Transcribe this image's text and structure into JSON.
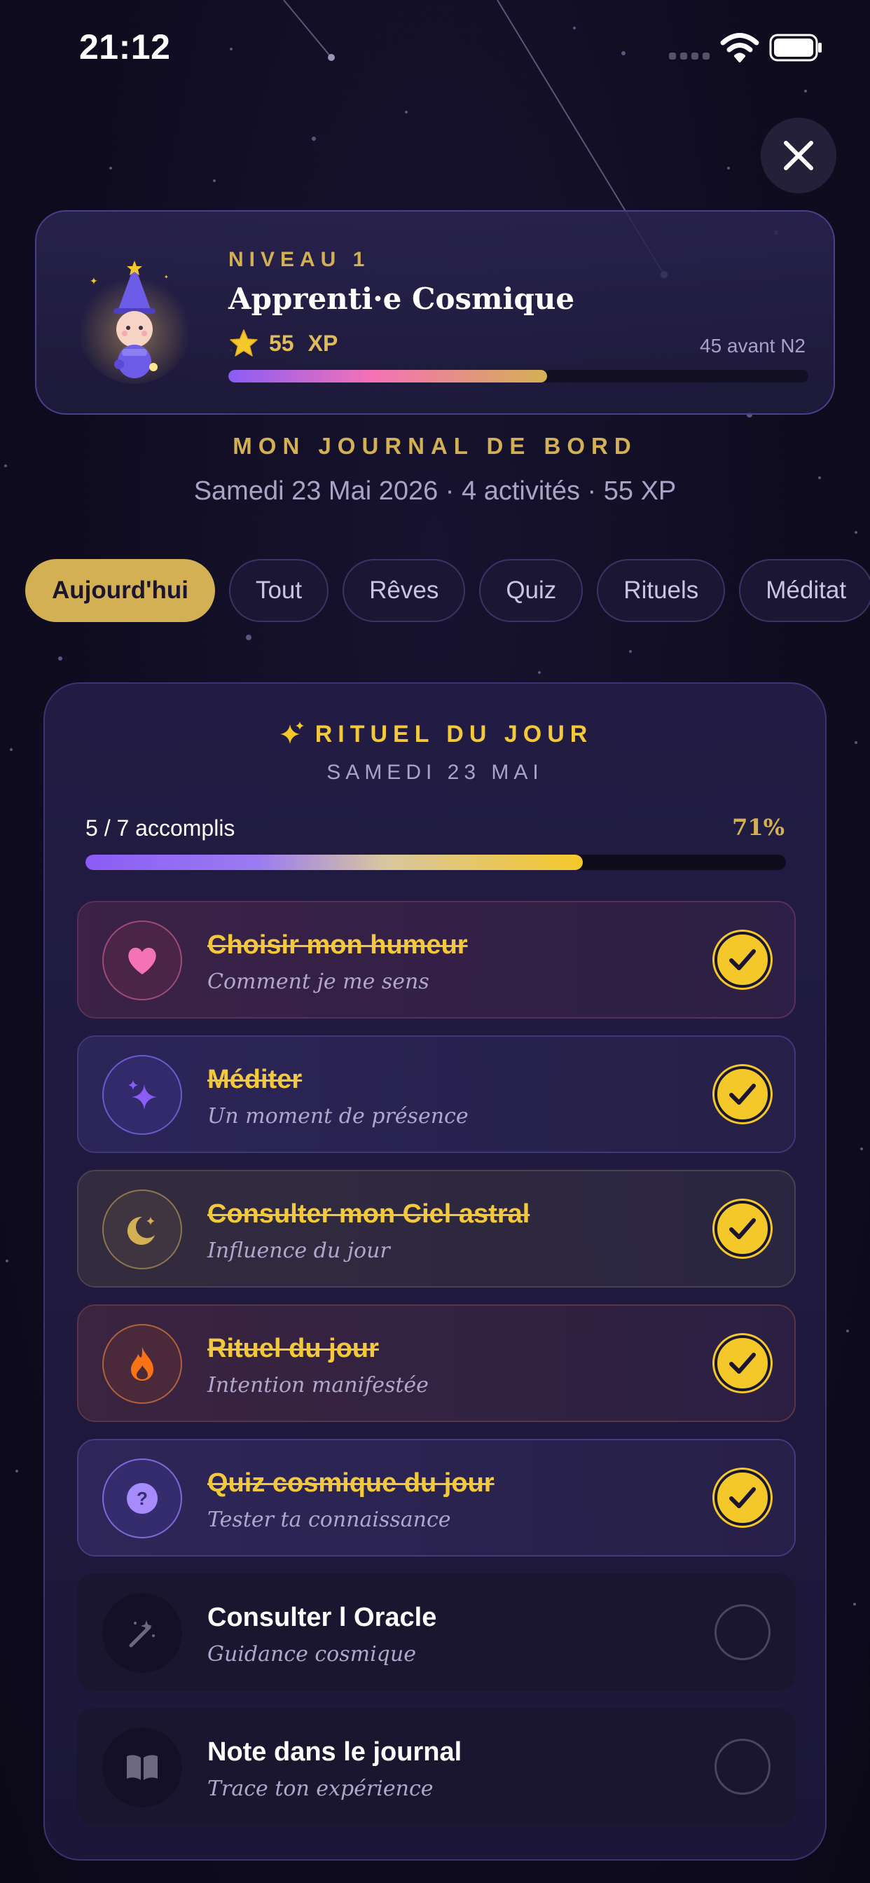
{
  "status_bar": {
    "time": "21:12"
  },
  "level_card": {
    "level_label": "NIVEAU 1",
    "title": "Apprenti·e Cosmique",
    "xp_value": "55",
    "xp_unit": "XP",
    "next_level_text": "45 avant N2",
    "xp_progress": 0.55
  },
  "journal": {
    "title": "MON JOURNAL DE BORD",
    "subtitle": "Samedi 23 Mai 2026 · 4 activités · 55 XP"
  },
  "tabs": [
    {
      "label": "Aujourd'hui",
      "active": true
    },
    {
      "label": "Tout"
    },
    {
      "label": "Rêves"
    },
    {
      "label": "Quiz"
    },
    {
      "label": "Rituels"
    },
    {
      "label": "Méditat"
    }
  ],
  "ritual": {
    "title": "RITUEL DU JOUR",
    "date": "SAMEDI 23 MAI",
    "progress_label": "5 / 7 accomplis",
    "progress_percent": "71%",
    "progress_value": 0.71,
    "tasks": [
      {
        "title": "Choisir mon humeur",
        "subtitle": "Comment je me sens",
        "done": true,
        "icon": "heart-icon",
        "color": "#f472b6"
      },
      {
        "title": "Méditer",
        "subtitle": "Un moment de présence",
        "done": true,
        "icon": "sparkles-icon",
        "color": "#8b5cf6"
      },
      {
        "title": "Consulter mon Ciel astral",
        "subtitle": "Influence du jour",
        "done": true,
        "icon": "moon-icon",
        "color": "#d4b054"
      },
      {
        "title": "Rituel du jour",
        "subtitle": "Intention manifestée",
        "done": true,
        "icon": "flame-icon",
        "color": "#f97316"
      },
      {
        "title": "Quiz cosmique du jour",
        "subtitle": "Tester ta connaissance",
        "done": true,
        "icon": "question-icon",
        "color": "#a78bfa"
      },
      {
        "title": "Consulter l Oracle",
        "subtitle": "Guidance cosmique",
        "done": false,
        "icon": "wand-icon",
        "color": "#6b6880"
      },
      {
        "title": "Note dans le journal",
        "subtitle": "Trace ton expérience",
        "done": false,
        "icon": "book-icon",
        "color": "#6b6880"
      }
    ]
  }
}
